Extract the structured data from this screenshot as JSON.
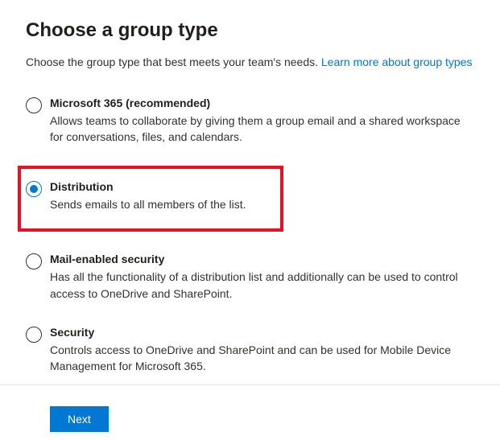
{
  "title": "Choose a group type",
  "intro_text": "Choose the group type that best meets your team's needs. ",
  "learn_more_label": "Learn more about group types",
  "options": [
    {
      "label": "Microsoft 365 (recommended)",
      "description": "Allows teams to collaborate by giving them a group email and a shared workspace for conversations, files, and calendars.",
      "selected": false,
      "highlighted": false
    },
    {
      "label": "Distribution",
      "description": "Sends emails to all members of the list.",
      "selected": true,
      "highlighted": true
    },
    {
      "label": "Mail-enabled security",
      "description": "Has all the functionality of a distribution list and additionally can be used to control access to OneDrive and SharePoint.",
      "selected": false,
      "highlighted": false
    },
    {
      "label": "Security",
      "description": "Controls access to OneDrive and SharePoint and can be used for Mobile Device Management for Microsoft 365.",
      "selected": false,
      "highlighted": false
    }
  ],
  "footer": {
    "next_label": "Next"
  }
}
